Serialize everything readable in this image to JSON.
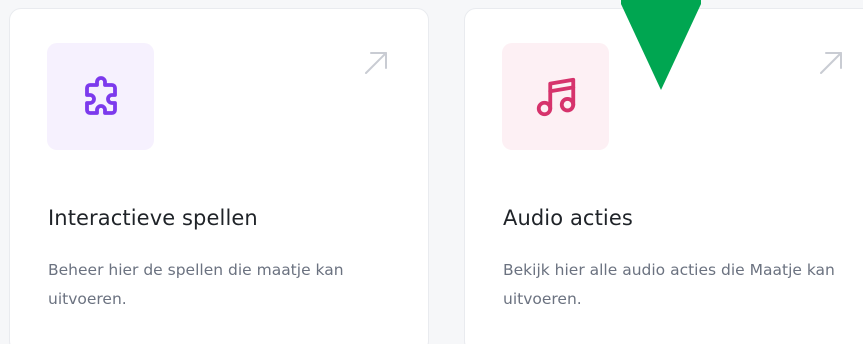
{
  "cards": [
    {
      "title": "Interactieve spellen",
      "description": "Beheer hier de spellen die maatje kan uitvoeren.",
      "icon": "puzzle-icon",
      "icon_color": "#7c3aed",
      "tile_color": "#f6f1fe"
    },
    {
      "title": "Audio acties",
      "description": "Bekijk hier alle audio acties die Maatje kan uitvoeren.",
      "icon": "music-note-icon",
      "icon_color": "#d6336c",
      "tile_color": "#fdf0f4"
    }
  ],
  "overlay": {
    "icon": "arrow-down-icon",
    "color": "#00a651"
  }
}
